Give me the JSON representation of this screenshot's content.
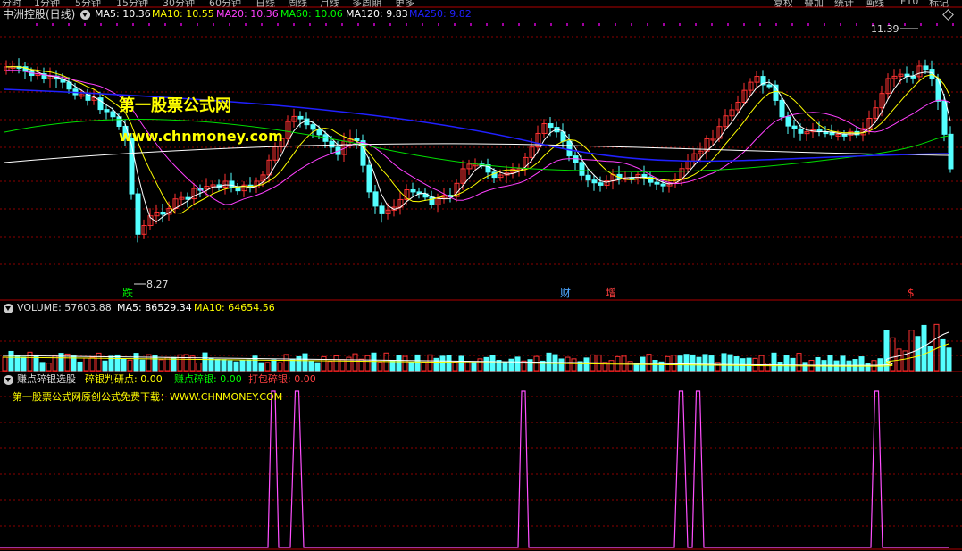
{
  "top_tabs": [
    "分时",
    "1分钟",
    "5分钟",
    "15分钟",
    "30分钟",
    "60分钟",
    "日线",
    "周线",
    "月线",
    "多周期",
    "更多"
  ],
  "top_right_buttons": [
    "复权",
    "叠加",
    "统计",
    "画线",
    "F10",
    "标记"
  ],
  "main_panel": {
    "title": "中洲控股(日线)",
    "indicators": [
      {
        "label": "MA5: 10.36",
        "color": "#ffffff"
      },
      {
        "label": "MA10: 10.55",
        "color": "#ffff00"
      },
      {
        "label": "MA20: 10.36",
        "color": "#ff40ff"
      },
      {
        "label": "MA60: 10.06",
        "color": "#00ff00"
      },
      {
        "label": "MA120: 9.83",
        "color": "#ffffff"
      },
      {
        "label": "MA250: 9.82",
        "color": "#2020ff"
      }
    ],
    "high_label": "11.39",
    "low_label": "8.27",
    "markers": [
      {
        "text": "跌",
        "color": "#00ff00"
      },
      {
        "text": "财",
        "color": "#4da6ff"
      },
      {
        "text": "增",
        "color": "#ff4040"
      },
      {
        "text": "$",
        "color": "#ff3030"
      }
    ],
    "watermark_title": "第一股票公式网",
    "watermark_url": "www.chnmoney.com"
  },
  "volume_panel": {
    "labels": [
      {
        "text": "VOLUME: 57603.88",
        "color": "#dddddd"
      },
      {
        "text": "MA5: 86529.34",
        "color": "#ffffff"
      },
      {
        "text": "MA10: 64654.56",
        "color": "#ffff00"
      }
    ]
  },
  "indicator_panel": {
    "labels": [
      {
        "text": "赚点碎银选股",
        "color": "#dddddd"
      },
      {
        "text": "碎银判研点: 0.00",
        "color": "#ffff00"
      },
      {
        "text": "赚点碎银: 0.00",
        "color": "#00ff00"
      },
      {
        "text": "打包碎银: 0.00",
        "color": "#ff4040"
      }
    ],
    "note": "第一股票公式网原创公式免费下载：WWW.CHNMONEY.COM"
  },
  "colors": {
    "up": "#ff3232",
    "down": "#54ffff",
    "grid": "#8b0000",
    "separator": "#b00000",
    "signal": "#ff50ff"
  }
}
